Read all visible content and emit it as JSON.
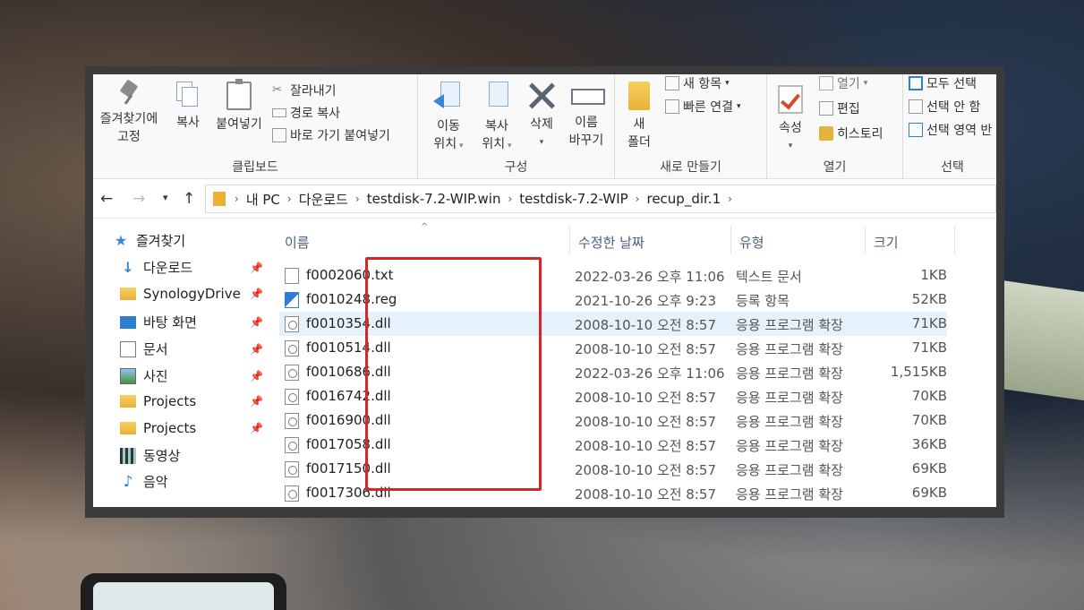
{
  "ribbon": {
    "clipboard": {
      "pin_label_1": "즐겨찾기에",
      "pin_label_2": "고정",
      "copy_label": "복사",
      "paste_label": "붙여넣기",
      "cut_label": "잘라내기",
      "copy_path_label": "경로 복사",
      "paste_shortcut_label": "바로 가기 붙여넣기",
      "group_name": "클립보드"
    },
    "organize": {
      "move_label_1": "이동",
      "move_label_2": "위치",
      "copyto_label_1": "복사",
      "copyto_label_2": "위치",
      "delete_label": "삭제",
      "rename_label_1": "이름",
      "rename_label_2": "바꾸기",
      "group_name": "구성"
    },
    "new": {
      "new_item_label": "새 항목",
      "easy_access_label": "빠른 연결",
      "new_folder_label_1": "새",
      "new_folder_label_2": "폴더",
      "group_name": "새로 만들기"
    },
    "open": {
      "properties_label": "속성",
      "open_label": "열기",
      "edit_label": "편집",
      "history_label": "히스토리",
      "group_name": "열기"
    },
    "select": {
      "select_all_label": "모두 선택",
      "select_none_label": "선택 안 함",
      "invert_label": "선택 영역 반",
      "group_name": "선택"
    }
  },
  "address": {
    "crumbs": [
      "내 PC",
      "다운로드",
      "testdisk-7.2-WIP.win",
      "testdisk-7.2-WIP",
      "recup_dir.1"
    ]
  },
  "sidebar": {
    "items": [
      {
        "label": "즐겨찾기",
        "icon": "star-icon",
        "pinned": false
      },
      {
        "label": "다운로드",
        "icon": "download-icon",
        "pinned": true
      },
      {
        "label": "SynologyDrive",
        "icon": "folder-icon",
        "pinned": true
      },
      {
        "label": "바탕 화면",
        "icon": "desktop-icon",
        "pinned": true
      },
      {
        "label": "문서",
        "icon": "document-icon",
        "pinned": true
      },
      {
        "label": "사진",
        "icon": "pictures-icon",
        "pinned": true
      },
      {
        "label": "Projects",
        "icon": "folder-icon",
        "pinned": true
      },
      {
        "label": "Projects",
        "icon": "folder-icon",
        "pinned": true
      },
      {
        "label": "동영상",
        "icon": "video-icon",
        "pinned": false
      },
      {
        "label": "음악",
        "icon": "music-icon",
        "pinned": false
      }
    ]
  },
  "columns": {
    "name": "이름",
    "date": "수정한 날짜",
    "type": "유형",
    "size": "크기"
  },
  "files": [
    {
      "name": "f0002060.txt",
      "date": "2022-03-26 오후 11:06",
      "type": "텍스트 문서",
      "size": "1KB",
      "icon": "txt"
    },
    {
      "name": "f0010248.reg",
      "date": "2021-10-26 오후 9:23",
      "type": "등록 항목",
      "size": "52KB",
      "icon": "reg"
    },
    {
      "name": "f0010354.dll",
      "date": "2008-10-10 오전 8:57",
      "type": "응용 프로그램 확장",
      "size": "71KB",
      "icon": "dll"
    },
    {
      "name": "f0010514.dll",
      "date": "2008-10-10 오전 8:57",
      "type": "응용 프로그램 확장",
      "size": "71KB",
      "icon": "dll"
    },
    {
      "name": "f0010686.dll",
      "date": "2022-03-26 오후 11:06",
      "type": "응용 프로그램 확장",
      "size": "1,515KB",
      "icon": "dll"
    },
    {
      "name": "f0016742.dll",
      "date": "2008-10-10 오전 8:57",
      "type": "응용 프로그램 확장",
      "size": "70KB",
      "icon": "dll"
    },
    {
      "name": "f0016900.dll",
      "date": "2008-10-10 오전 8:57",
      "type": "응용 프로그램 확장",
      "size": "70KB",
      "icon": "dll"
    },
    {
      "name": "f0017058.dll",
      "date": "2008-10-10 오전 8:57",
      "type": "응용 프로그램 확장",
      "size": "36KB",
      "icon": "dll"
    },
    {
      "name": "f0017150.dll",
      "date": "2008-10-10 오전 8:57",
      "type": "응용 프로그램 확장",
      "size": "69KB",
      "icon": "dll"
    },
    {
      "name": "f0017306.dll",
      "date": "2008-10-10 오전 8:57",
      "type": "응용 프로그램 확장",
      "size": "69KB",
      "icon": "dll"
    }
  ],
  "colors": {
    "highlight": "#d5262a",
    "selected_row": "#e5f1fb",
    "accent": "#2f7fd1"
  }
}
